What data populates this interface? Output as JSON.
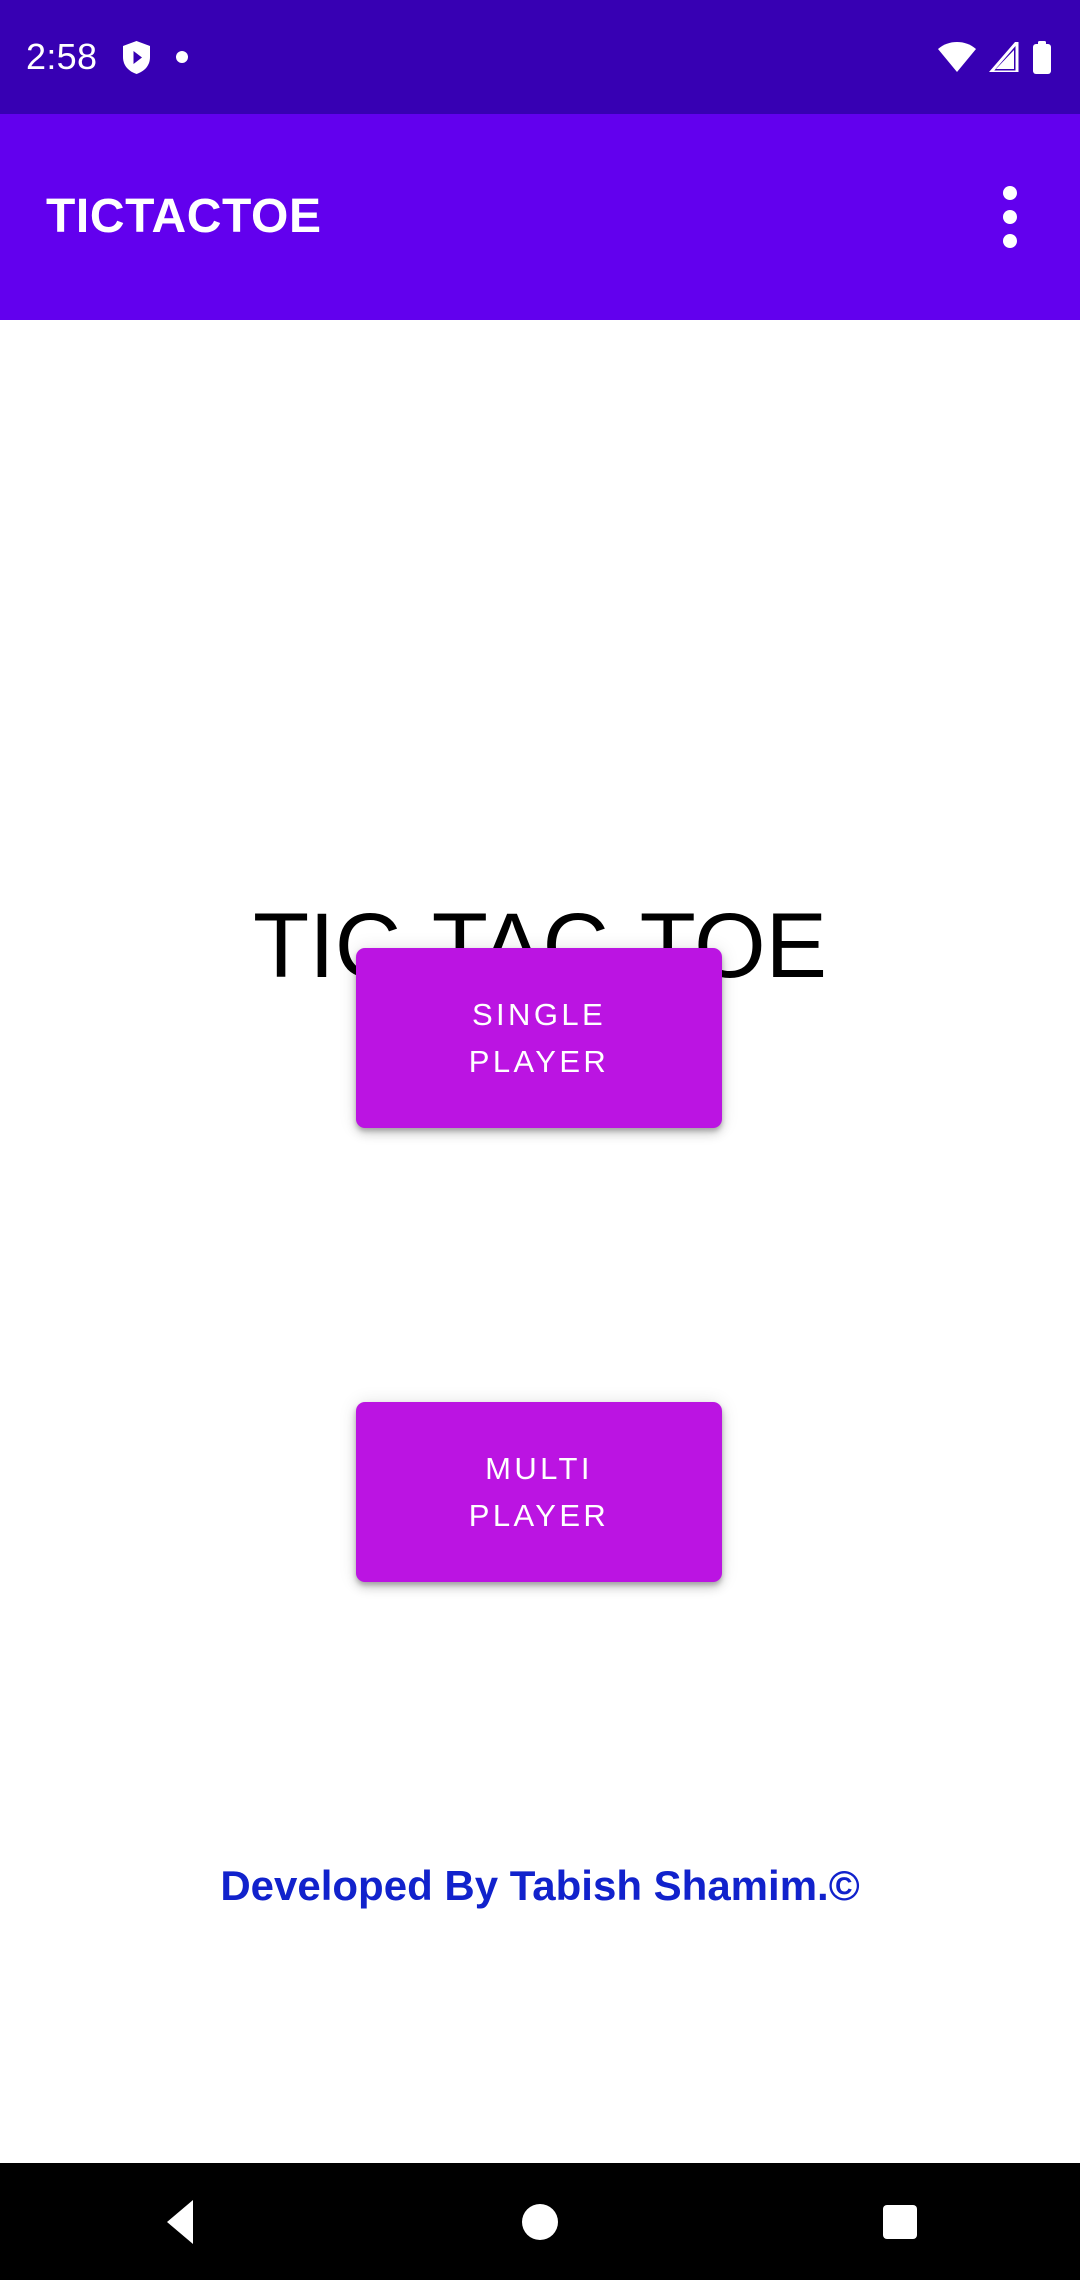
{
  "status_bar": {
    "clock": "2:58",
    "background_color": "#3700B3",
    "icons": {
      "play_protect": "shield-icon",
      "notification_dot": "dot-icon",
      "wifi": "wifi-icon",
      "signal": "signal-icon",
      "battery": "battery-icon"
    }
  },
  "app_bar": {
    "title": "TICTACTOE",
    "background_color": "#6200EE",
    "title_color": "#FFFFFF",
    "overflow_menu": "overflow-menu-icon"
  },
  "main": {
    "heading": "TIC-TAC-TOE",
    "heading_color": "#000000",
    "buttons": [
      {
        "id": "single-player",
        "label": "SINGLE\nPLAYER",
        "background_color": "#BB14E2",
        "text_color": "#FFFFFF"
      },
      {
        "id": "multi-player",
        "label": "MULTI\nPLAYER",
        "background_color": "#BB14E2",
        "text_color": "#FFFFFF"
      }
    ],
    "footer_credit": "Developed By Tabish Shamim.©",
    "footer_credit_color": "#1122CC",
    "background_color": "#FFFFFF"
  },
  "nav_bar": {
    "background_color": "#000000",
    "back": "back-triangle-icon",
    "home": "home-circle-icon",
    "recents": "recents-square-icon"
  }
}
